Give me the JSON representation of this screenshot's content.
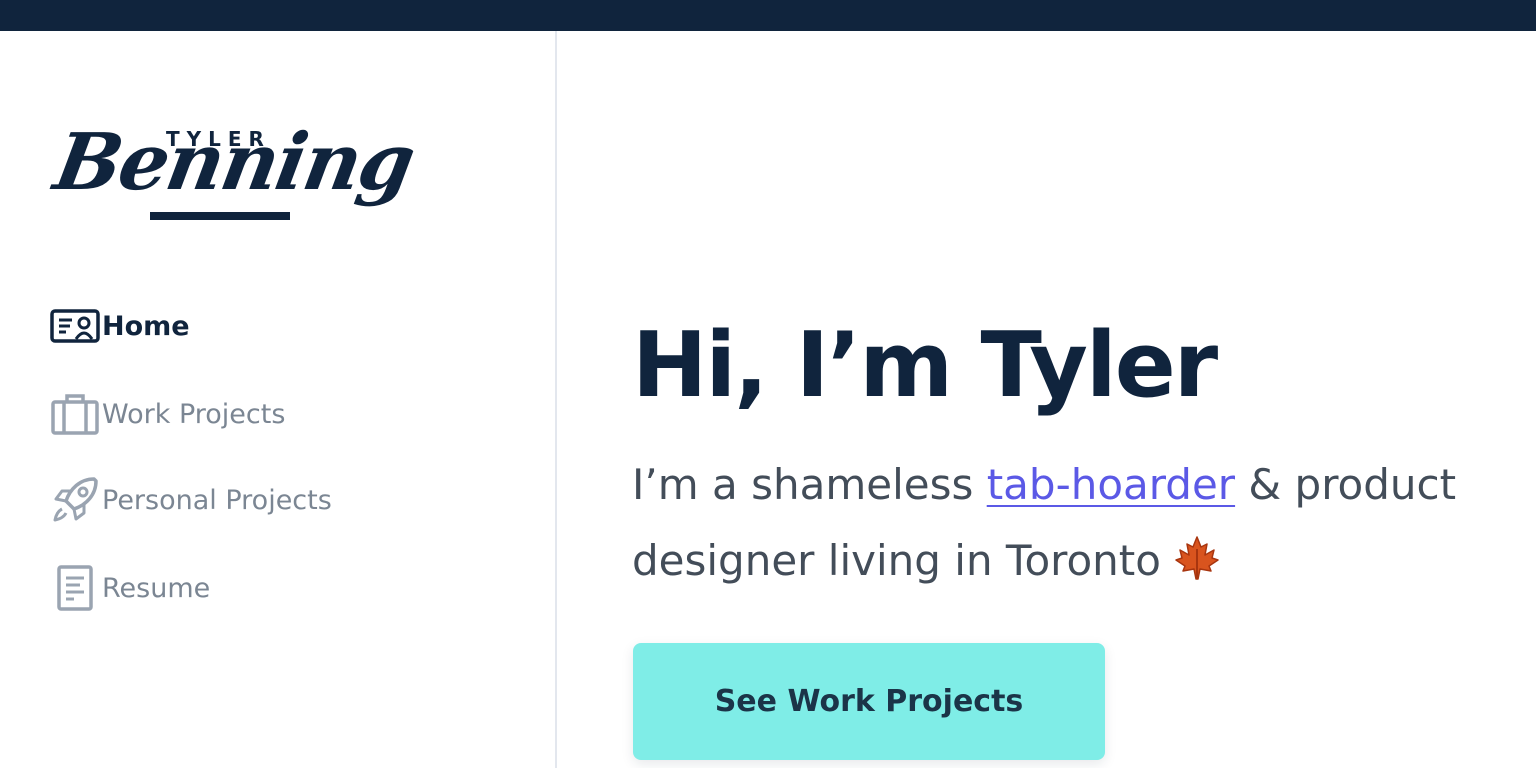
{
  "logo": {
    "top_text": "TYLER",
    "script_text": "Benning"
  },
  "nav": {
    "items": [
      {
        "label": "Home",
        "icon": "id-card-icon",
        "active": true
      },
      {
        "label": "Work Projects",
        "icon": "briefcase-icon",
        "active": false
      },
      {
        "label": "Personal Projects",
        "icon": "rocket-icon",
        "active": false
      },
      {
        "label": "Resume",
        "icon": "document-icon",
        "active": false
      }
    ]
  },
  "hero": {
    "headline": "Hi, I’m Tyler",
    "intro_prefix": "I’m a shameless ",
    "intro_link": "tab-hoarder",
    "intro_suffix": " & product designer living in Toronto ",
    "emoji_icon": "maple-leaf-icon",
    "cta_label": "See Work Projects"
  },
  "colors": {
    "navy": "#10243d",
    "muted": "#7b8693",
    "link": "#5b59e6",
    "cta_bg": "#7fede7",
    "divider": "#e3e7ee"
  }
}
